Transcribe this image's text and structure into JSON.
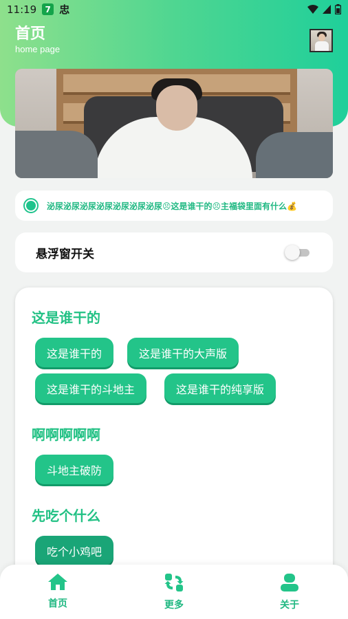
{
  "status_bar": {
    "time": "11:19",
    "badge": "7",
    "glyph": "忠"
  },
  "header": {
    "title": "首页",
    "subtitle": "home page"
  },
  "ticker": {
    "text": "泌尿泌尿泌尿泌尿泌尿泌尿泌尿😣这是谁干的😣主福袋里面有什么💰"
  },
  "float_toggle": {
    "label": "悬浮窗开关",
    "enabled": false
  },
  "sections": [
    {
      "title": "这是谁干的",
      "buttons": [
        "这是谁干的",
        "这是谁干的大声版",
        "这是谁干的斗地主",
        "这是谁干的纯享版"
      ]
    },
    {
      "title": "啊啊啊啊啊",
      "buttons": [
        "斗地主破防"
      ]
    },
    {
      "title": "先吃个什么",
      "buttons": [
        "吃个小鸡吧"
      ]
    }
  ],
  "bottom_nav": [
    {
      "label": "首页",
      "icon": "home-icon",
      "active": true
    },
    {
      "label": "更多",
      "icon": "swap-icon",
      "active": false
    },
    {
      "label": "关于",
      "icon": "person-icon",
      "active": false
    }
  ],
  "colors": {
    "accent": "#23c489",
    "accent_dark": "#1aa577",
    "header_gradient_start": "#8ee08c",
    "header_gradient_end": "#1fcf9a"
  }
}
